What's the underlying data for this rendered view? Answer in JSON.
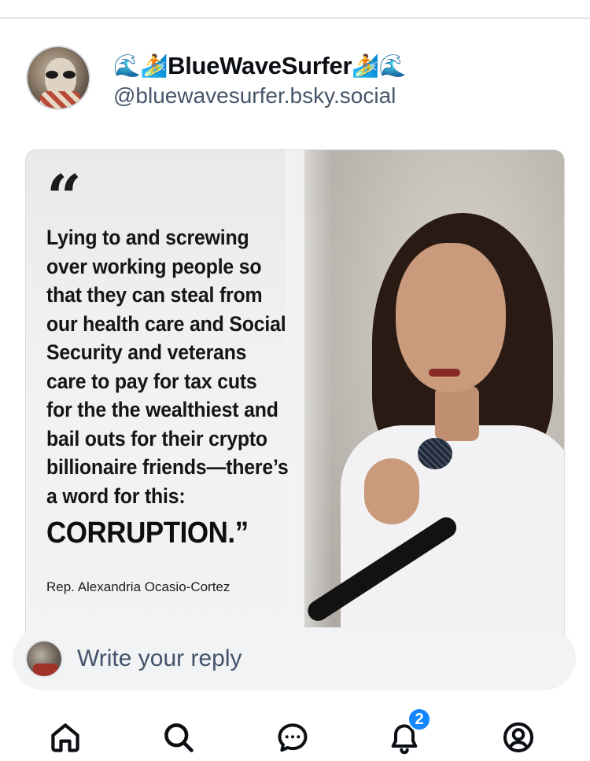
{
  "author": {
    "display_name": "BlueWaveSurfer",
    "handle": "@bluewavesurfer.bsky.social",
    "emoji_left": "🌊🏄",
    "emoji_right": "🏄🌊"
  },
  "post_image": {
    "quote_mark": "“",
    "quote_lines": [
      "Lying to and screwing",
      "over working people so",
      "that they can steal from",
      "our health care and Social",
      "Security and veterans",
      "care to pay for tax cuts",
      "for the the wealthiest and",
      "bail outs for their crypto",
      "billionaire friends—there’s",
      "a word for this:"
    ],
    "quote_word": "CORRUPTION.”",
    "attribution": "Rep. Alexandria Ocasio-Cortez"
  },
  "reply": {
    "placeholder": "Write your reply"
  },
  "nav": {
    "items": [
      {
        "name": "home",
        "icon": "home-icon"
      },
      {
        "name": "search",
        "icon": "search-icon"
      },
      {
        "name": "chat",
        "icon": "chat-icon"
      },
      {
        "name": "notifications",
        "icon": "bell-icon",
        "badge": "2"
      },
      {
        "name": "profile",
        "icon": "profile-icon"
      }
    ]
  },
  "colors": {
    "accent": "#1486ff",
    "text": "#0b0f14",
    "muted": "#46566a"
  }
}
